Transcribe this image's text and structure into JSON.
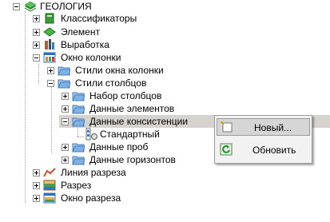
{
  "tree": {
    "root": {
      "label": "ГЕОЛОГИЯ",
      "icon": "geology-layers-icon"
    },
    "items": [
      {
        "label": "Классификаторы",
        "icon": "book-icon"
      },
      {
        "label": "Элемент",
        "icon": "diamond-icon"
      },
      {
        "label": "Выработка",
        "icon": "drill-rig-icon"
      },
      {
        "label": "Окно колонки",
        "icon": "column-window-icon"
      },
      {
        "label": "Стили окна колонки",
        "icon": "folder-icon"
      },
      {
        "label": "Стили столбцов",
        "icon": "folder-icon"
      },
      {
        "label": "Набор столбцов",
        "icon": "folder-icon"
      },
      {
        "label": "Данные элементов",
        "icon": "folder-icon"
      },
      {
        "label": "Данные консистенции",
        "icon": "folder-icon"
      },
      {
        "label": "Стандартный",
        "icon": "style-item-icon"
      },
      {
        "label": "Данные проб",
        "icon": "folder-icon"
      },
      {
        "label": "Данные горизонтов",
        "icon": "folder-icon"
      },
      {
        "label": "Линия разреза",
        "icon": "section-line-icon"
      },
      {
        "label": "Разрез",
        "icon": "section-icon"
      },
      {
        "label": "Окно разреза",
        "icon": "section-window-icon"
      }
    ]
  },
  "context_menu": {
    "items": [
      {
        "label": "Новый...",
        "icon": "new-item-icon"
      },
      {
        "label": "Обновить",
        "icon": "refresh-icon"
      }
    ]
  },
  "colors": {
    "selection": "#d6d3ce",
    "folder": "#7fb2e6",
    "menu_bg": "#f2f2f2"
  }
}
